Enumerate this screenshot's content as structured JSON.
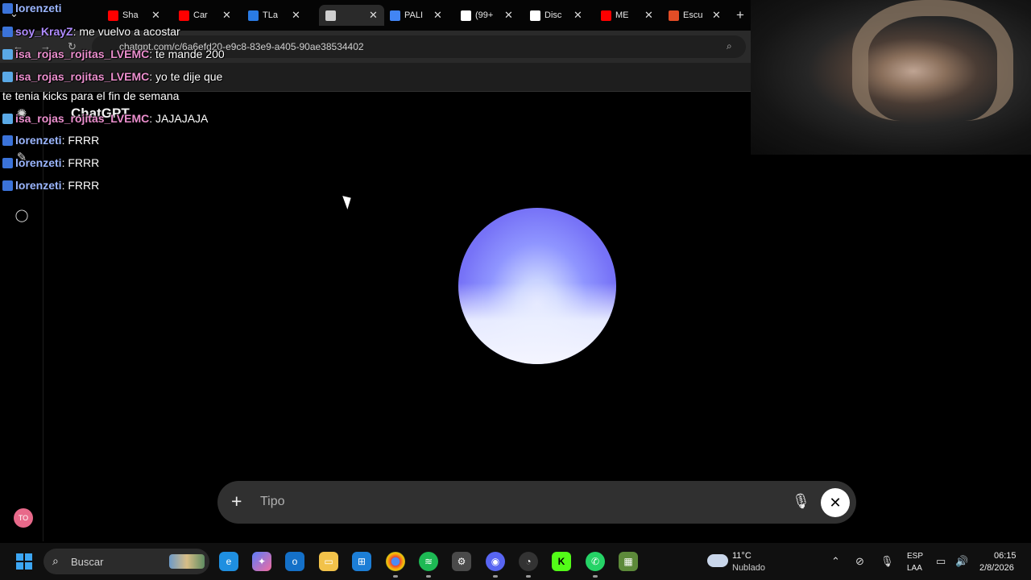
{
  "browser": {
    "tabs": [
      {
        "title": "Sha",
        "color": "#ff0000"
      },
      {
        "title": "Car",
        "color": "#ff0000"
      },
      {
        "title": "TLa",
        "color": "#2a7be4"
      },
      {
        "title": "",
        "color": "#cfcfcf"
      },
      {
        "title": "PALI",
        "color": "#4285f4"
      },
      {
        "title": "(99+",
        "color": "#ffffff"
      },
      {
        "title": "Disc",
        "color": "#ffffff"
      },
      {
        "title": "ME",
        "color": "#ff0000"
      },
      {
        "title": "Escu",
        "color": "#e34d26"
      }
    ],
    "url": "chatgpt.com/c/6a6efd20-e9c8-83e9-a405-90ae38534402"
  },
  "app": {
    "title": "ChatGPT",
    "avatar_initials": "TO"
  },
  "composer": {
    "placeholder": "Tipo"
  },
  "chat": {
    "messages": [
      {
        "user": "lorenzeti",
        "text": "",
        "style": "u-blue"
      },
      {
        "user": "soy_KrayZ",
        "text": ": me vuelvo a acostar",
        "style": "u-purple"
      },
      {
        "user": "isa_rojas_rojitas_LVEMC",
        "text": ": te mande 200",
        "style": "u-pink"
      },
      {
        "user": "isa_rojas_rojitas_LVEMC",
        "text": ": yo te dije que",
        "style": "u-pink"
      },
      {
        "user": "",
        "text": "te tenia kicks para el fin de semana",
        "style": ""
      },
      {
        "user": "isa_rojas_rojitas_LVEMC",
        "text": ": JAJAJAJA",
        "style": "u-pink"
      },
      {
        "user": "lorenzeti",
        "text": ": FRRR",
        "style": "u-blue"
      },
      {
        "user": "lorenzeti",
        "text": ": FRRR",
        "style": "u-blue"
      },
      {
        "user": "lorenzeti",
        "text": ": FRRR",
        "style": "u-blue"
      }
    ]
  },
  "taskbar": {
    "search_label": "Buscar",
    "weather_temp": "11°C",
    "weather_cond": "Nublado",
    "lang": "ESP",
    "layout": "LAA",
    "time": "06:15",
    "date": "2/8/2026"
  }
}
